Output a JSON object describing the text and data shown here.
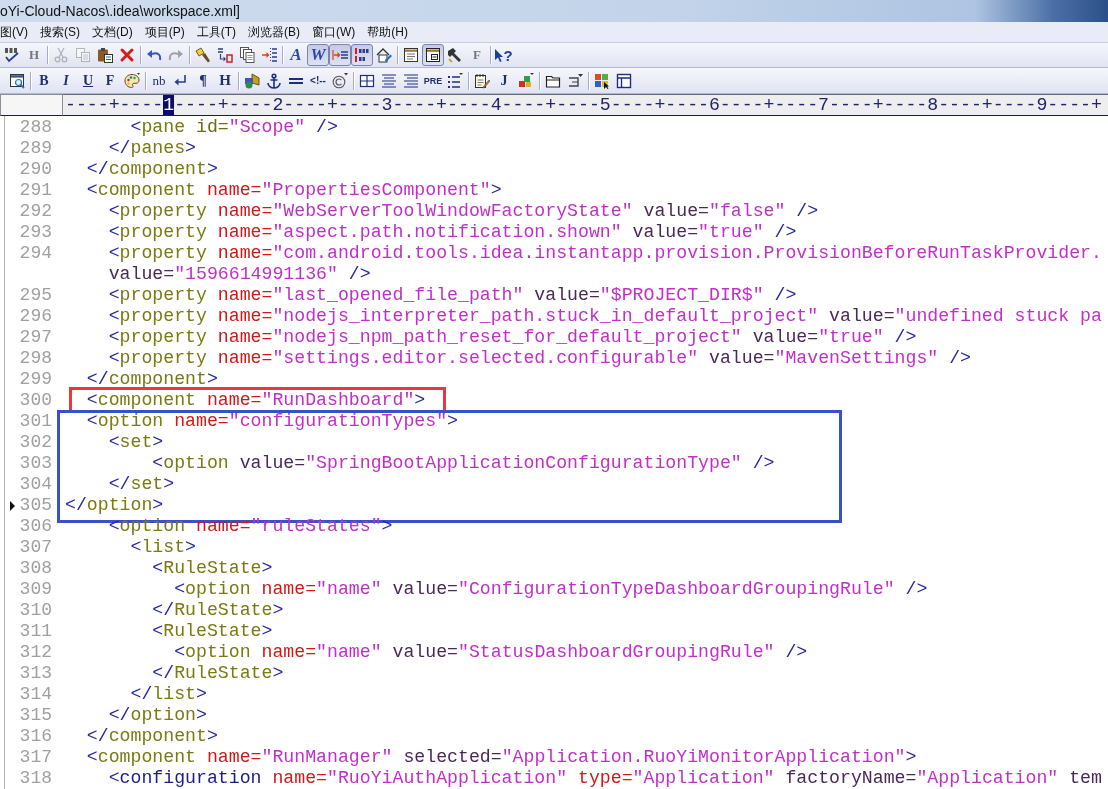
{
  "title_bar": {
    "title": "oYi-Cloud-Nacos\\.idea\\workspace.xml]"
  },
  "menu_bar": [
    "图(V)",
    "搜索(S)",
    "文档(D)",
    "项目(P)",
    "工具(T)",
    "浏览器(B)",
    "窗口(W)",
    "帮助(H)"
  ],
  "toolbars": [
    {
      "groups": [
        [
          {
            "kind": "command",
            "disabled": false
          },
          {
            "kind": "command",
            "label": "H",
            "disabled": false
          }
        ],
        [
          {
            "kind": "command",
            "disabled": true
          },
          {
            "kind": "command",
            "disabled": true
          },
          {
            "kind": "command",
            "disabled": false
          },
          {
            "kind": "command",
            "disabled": false
          }
        ],
        [
          {
            "kind": "command",
            "disabled": false
          },
          {
            "kind": "command",
            "disabled": true
          }
        ],
        [
          {
            "kind": "command",
            "disabled": false
          },
          {
            "kind": "command",
            "disabled": false
          },
          {
            "kind": "command",
            "disabled": false
          },
          {
            "kind": "command",
            "disabled": false
          }
        ],
        [
          {
            "kind": "command",
            "label": "A",
            "disabled": false
          },
          {
            "kind": "toggle",
            "label": "W",
            "pressed": true,
            "disabled": false
          },
          {
            "kind": "toggle",
            "pressed": true,
            "disabled": false
          },
          {
            "kind": "toggle",
            "pressed": true,
            "disabled": false
          },
          {
            "kind": "command",
            "disabled": false
          }
        ],
        [
          {
            "kind": "command",
            "disabled": false
          },
          {
            "kind": "toggle",
            "pressed": true,
            "disabled": false
          },
          {
            "kind": "command",
            "disabled": false
          },
          {
            "kind": "command",
            "label": "F",
            "disabled": false
          }
        ],
        [
          {
            "kind": "command",
            "label": "?",
            "disabled": false
          }
        ]
      ]
    },
    {
      "groups": [
        [
          {
            "kind": "command",
            "disabled": false
          }
        ],
        [
          {
            "kind": "command",
            "label": "B",
            "disabled": false
          },
          {
            "kind": "command",
            "label": "I",
            "disabled": false
          },
          {
            "kind": "command",
            "label": "U",
            "disabled": false
          },
          {
            "kind": "command",
            "label": "F",
            "disabled": false
          },
          {
            "kind": "command",
            "disabled": false
          }
        ],
        [
          {
            "kind": "command",
            "label": "nb",
            "disabled": false
          },
          {
            "kind": "command",
            "disabled": false
          },
          {
            "kind": "command",
            "label": "¶",
            "disabled": false
          },
          {
            "kind": "command",
            "label": "H",
            "disabled": false
          }
        ],
        [
          {
            "kind": "command",
            "disabled": false
          },
          {
            "kind": "command",
            "disabled": false
          },
          {
            "kind": "command",
            "disabled": false
          },
          {
            "kind": "command",
            "label": "<!--",
            "disabled": false
          },
          {
            "kind": "command",
            "disabled": false
          }
        ],
        [
          {
            "kind": "command",
            "disabled": false
          },
          {
            "kind": "command",
            "disabled": false
          },
          {
            "kind": "command",
            "disabled": false
          },
          {
            "kind": "command",
            "label": "PRE",
            "disabled": false
          },
          {
            "kind": "command",
            "disabled": false
          }
        ],
        [
          {
            "kind": "command",
            "disabled": false
          },
          {
            "kind": "command",
            "label": "J",
            "disabled": false
          },
          {
            "kind": "command",
            "disabled": false
          }
        ],
        [
          {
            "kind": "command",
            "disabled": false
          },
          {
            "kind": "command",
            "disabled": false
          }
        ],
        [
          {
            "kind": "command",
            "disabled": false
          },
          {
            "kind": "command",
            "disabled": false
          }
        ]
      ]
    }
  ],
  "ruler": [
    {
      "text": "----+----",
      "highlighted": false
    },
    {
      "text": "1",
      "highlighted": true
    },
    {
      "text": "----+----2----+----3----+----4----+----5----+----6----+----7----+----8----+----9----+",
      "highlighted": false
    }
  ],
  "code": {
    "blocks": [
      {
        "rows": [
          {
            "number": "288",
            "current": false,
            "tokens": [
              {
                "kind": "bracket",
                "text": "      <"
              },
              {
                "kind": "tag",
                "text": "pane"
              },
              {
                "kind": "property",
                "text": " id="
              },
              {
                "kind": "string",
                "text": "\"Scope\""
              },
              {
                "kind": "bracket",
                "text": " />"
              }
            ]
          },
          {
            "number": "289",
            "current": false,
            "tokens": [
              {
                "kind": "bracket",
                "text": "    </"
              },
              {
                "kind": "tag",
                "text": "panes"
              },
              {
                "kind": "bracket",
                "text": ">"
              }
            ]
          },
          {
            "number": "290",
            "current": false,
            "tokens": [
              {
                "kind": "bracket",
                "text": "  </"
              },
              {
                "kind": "tag",
                "text": "component"
              },
              {
                "kind": "bracket",
                "text": ">"
              }
            ]
          },
          {
            "number": "291",
            "current": false,
            "tokens": [
              {
                "kind": "bracket",
                "text": "  <"
              },
              {
                "kind": "tag",
                "text": "component"
              },
              {
                "kind": "keyword",
                "text": " name="
              },
              {
                "kind": "string",
                "text": "\"PropertiesComponent\""
              },
              {
                "kind": "bracket",
                "text": ">"
              }
            ]
          },
          {
            "number": "292",
            "current": false,
            "tokens": [
              {
                "kind": "bracket",
                "text": "    <"
              },
              {
                "kind": "tag",
                "text": "property"
              },
              {
                "kind": "keyword",
                "text": " name="
              },
              {
                "kind": "string",
                "text": "\"WebServerToolWindowFactoryState\""
              },
              {
                "kind": "attribute",
                "text": " value="
              },
              {
                "kind": "string",
                "text": "\"false\""
              },
              {
                "kind": "bracket",
                "text": " />"
              }
            ]
          },
          {
            "number": "293",
            "current": false,
            "tokens": [
              {
                "kind": "bracket",
                "text": "    <"
              },
              {
                "kind": "tag",
                "text": "property"
              },
              {
                "kind": "keyword",
                "text": " name="
              },
              {
                "kind": "string",
                "text": "\"aspect.path.notification.shown\""
              },
              {
                "kind": "attribute",
                "text": " value="
              },
              {
                "kind": "string",
                "text": "\"true\""
              },
              {
                "kind": "bracket",
                "text": " />"
              }
            ]
          },
          {
            "number": "294",
            "current": false,
            "tokens": [
              {
                "kind": "bracket",
                "text": "    <"
              },
              {
                "kind": "tag",
                "text": "property"
              },
              {
                "kind": "keyword",
                "text": " name="
              },
              {
                "kind": "string",
                "text": "\"com.android.tools.idea.instantapp.provision.ProvisionBeforeRunTaskProvider."
              }
            ]
          },
          {
            "current": false,
            "tokens": [
              {
                "kind": "attribute",
                "text": "    value="
              },
              {
                "kind": "string",
                "text": "\"1596614991136\""
              },
              {
                "kind": "bracket",
                "text": " />"
              }
            ]
          },
          {
            "number": "295",
            "current": false,
            "tokens": [
              {
                "kind": "bracket",
                "text": "    <"
              },
              {
                "kind": "tag",
                "text": "property"
              },
              {
                "kind": "keyword",
                "text": " name="
              },
              {
                "kind": "string",
                "text": "\"last_opened_file_path\""
              },
              {
                "kind": "attribute",
                "text": " value="
              },
              {
                "kind": "string",
                "text": "\"$PROJECT_DIR$\""
              },
              {
                "kind": "bracket",
                "text": " />"
              }
            ]
          },
          {
            "number": "296",
            "current": false,
            "tokens": [
              {
                "kind": "bracket",
                "text": "    <"
              },
              {
                "kind": "tag",
                "text": "property"
              },
              {
                "kind": "keyword",
                "text": " name="
              },
              {
                "kind": "string",
                "text": "\"nodejs_interpreter_path.stuck_in_default_project\""
              },
              {
                "kind": "attribute",
                "text": " value="
              },
              {
                "kind": "string",
                "text": "\"undefined stuck pa"
              }
            ]
          },
          {
            "number": "297",
            "current": false,
            "tokens": [
              {
                "kind": "bracket",
                "text": "    <"
              },
              {
                "kind": "tag",
                "text": "property"
              },
              {
                "kind": "keyword",
                "text": " name="
              },
              {
                "kind": "string",
                "text": "\"nodejs_npm_path_reset_for_default_project\""
              },
              {
                "kind": "attribute",
                "text": " value="
              },
              {
                "kind": "string",
                "text": "\"true\""
              },
              {
                "kind": "bracket",
                "text": " />"
              }
            ]
          },
          {
            "number": "298",
            "current": false,
            "tokens": [
              {
                "kind": "bracket",
                "text": "    <"
              },
              {
                "kind": "tag",
                "text": "property"
              },
              {
                "kind": "keyword",
                "text": " name="
              },
              {
                "kind": "string",
                "text": "\"settings.editor.selected.configurable\""
              },
              {
                "kind": "attribute",
                "text": " value="
              },
              {
                "kind": "string",
                "text": "\"MavenSettings\""
              },
              {
                "kind": "bracket",
                "text": " />"
              }
            ]
          },
          {
            "number": "299",
            "current": false,
            "tokens": [
              {
                "kind": "bracket",
                "text": "  </"
              },
              {
                "kind": "tag",
                "text": "component"
              },
              {
                "kind": "bracket",
                "text": ">"
              }
            ]
          }
        ]
      },
      {
        "frame": {
          "color": "#e8383c"
        },
        "rows": [
          {
            "number": "300",
            "current": false,
            "tokens": [
              {
                "kind": "bracket",
                "text": "  <"
              },
              {
                "kind": "tag",
                "text": "component"
              },
              {
                "kind": "keyword",
                "text": " name="
              },
              {
                "kind": "string",
                "text": "\"RunDashboard\""
              },
              {
                "kind": "bracket",
                "text": ">"
              }
            ]
          }
        ]
      },
      {
        "frame": {
          "color": "#3a50c6"
        },
        "rows": [
          {
            "number": "301",
            "current": false,
            "tokens": [
              {
                "kind": "bracket",
                "text": "  <"
              },
              {
                "kind": "tag",
                "text": "option"
              },
              {
                "kind": "keyword",
                "text": " name="
              },
              {
                "kind": "string",
                "text": "\"configurationTypes\""
              },
              {
                "kind": "bracket",
                "text": ">"
              }
            ]
          },
          {
            "number": "302",
            "current": false,
            "tokens": [
              {
                "kind": "bracket",
                "text": "    <"
              },
              {
                "kind": "tag",
                "text": "set"
              },
              {
                "kind": "bracket",
                "text": ">"
              }
            ]
          },
          {
            "number": "303",
            "current": false,
            "tokens": [
              {
                "kind": "bracket",
                "text": "        <"
              },
              {
                "kind": "tag",
                "text": "option"
              },
              {
                "kind": "attribute",
                "text": " value="
              },
              {
                "kind": "string",
                "text": "\"SpringBootApplicationConfigurationType\""
              },
              {
                "kind": "bracket",
                "text": " />"
              }
            ]
          },
          {
            "number": "304",
            "current": false,
            "tokens": [
              {
                "kind": "bracket",
                "text": "    </"
              },
              {
                "kind": "tag",
                "text": "set"
              },
              {
                "kind": "bracket",
                "text": ">"
              }
            ]
          },
          {
            "number": "305",
            "current": true,
            "tokens": [
              {
                "kind": "bracket",
                "text": "</"
              },
              {
                "kind": "tag",
                "text": "option"
              },
              {
                "kind": "bracket",
                "text": ">"
              }
            ]
          }
        ]
      },
      {
        "rows": [
          {
            "number": "306",
            "current": false,
            "tokens": [
              {
                "kind": "bracket",
                "text": "    <"
              },
              {
                "kind": "tag",
                "text": "option"
              },
              {
                "kind": "keyword",
                "text": " name="
              },
              {
                "kind": "string",
                "text": "\"ruleStates\""
              },
              {
                "kind": "bracket",
                "text": ">"
              }
            ]
          },
          {
            "number": "307",
            "current": false,
            "tokens": [
              {
                "kind": "bracket",
                "text": "      <"
              },
              {
                "kind": "tag",
                "text": "list"
              },
              {
                "kind": "bracket",
                "text": ">"
              }
            ]
          },
          {
            "number": "308",
            "current": false,
            "tokens": [
              {
                "kind": "bracket",
                "text": "        <"
              },
              {
                "kind": "tag",
                "text": "RuleState"
              },
              {
                "kind": "bracket",
                "text": ">"
              }
            ]
          },
          {
            "number": "309",
            "current": false,
            "tokens": [
              {
                "kind": "bracket",
                "text": "          <"
              },
              {
                "kind": "tag",
                "text": "option"
              },
              {
                "kind": "keyword",
                "text": " name="
              },
              {
                "kind": "string",
                "text": "\"name\""
              },
              {
                "kind": "attribute",
                "text": " value="
              },
              {
                "kind": "string",
                "text": "\"ConfigurationTypeDashboardGroupingRule\""
              },
              {
                "kind": "bracket",
                "text": " />"
              }
            ]
          },
          {
            "number": "310",
            "current": false,
            "tokens": [
              {
                "kind": "bracket",
                "text": "        </"
              },
              {
                "kind": "tag",
                "text": "RuleState"
              },
              {
                "kind": "bracket",
                "text": ">"
              }
            ]
          },
          {
            "number": "311",
            "current": false,
            "tokens": [
              {
                "kind": "bracket",
                "text": "        <"
              },
              {
                "kind": "tag",
                "text": "RuleState"
              },
              {
                "kind": "bracket",
                "text": ">"
              }
            ]
          },
          {
            "number": "312",
            "current": false,
            "tokens": [
              {
                "kind": "bracket",
                "text": "          <"
              },
              {
                "kind": "tag",
                "text": "option"
              },
              {
                "kind": "keyword",
                "text": " name="
              },
              {
                "kind": "string",
                "text": "\"name\""
              },
              {
                "kind": "attribute",
                "text": " value="
              },
              {
                "kind": "string",
                "text": "\"StatusDashboardGroupingRule\""
              },
              {
                "kind": "bracket",
                "text": " />"
              }
            ]
          },
          {
            "number": "313",
            "current": false,
            "tokens": [
              {
                "kind": "bracket",
                "text": "        </"
              },
              {
                "kind": "tag",
                "text": "RuleState"
              },
              {
                "kind": "bracket",
                "text": ">"
              }
            ]
          },
          {
            "number": "314",
            "current": false,
            "tokens": [
              {
                "kind": "bracket",
                "text": "      </"
              },
              {
                "kind": "tag",
                "text": "list"
              },
              {
                "kind": "bracket",
                "text": ">"
              }
            ]
          },
          {
            "number": "315",
            "current": false,
            "tokens": [
              {
                "kind": "bracket",
                "text": "    </"
              },
              {
                "kind": "tag",
                "text": "option"
              },
              {
                "kind": "bracket",
                "text": ">"
              }
            ]
          },
          {
            "number": "316",
            "current": false,
            "tokens": [
              {
                "kind": "bracket",
                "text": "  </"
              },
              {
                "kind": "tag",
                "text": "component"
              },
              {
                "kind": "bracket",
                "text": ">"
              }
            ]
          },
          {
            "number": "317",
            "current": false,
            "tokens": [
              {
                "kind": "bracket",
                "text": "  <"
              },
              {
                "kind": "tag",
                "text": "component"
              },
              {
                "kind": "keyword",
                "text": " name="
              },
              {
                "kind": "string",
                "text": "\"RunManager\""
              },
              {
                "kind": "attribute",
                "text": " selected="
              },
              {
                "kind": "string",
                "text": "\"Application.RuoYiMonitorApplication\""
              },
              {
                "kind": "bracket",
                "text": ">"
              }
            ]
          },
          {
            "number": "318",
            "current": false,
            "tokens": [
              {
                "kind": "bracket",
                "text": "    <"
              },
              {
                "kind": "element",
                "text": "configuration"
              },
              {
                "kind": "keyword",
                "text": " name="
              },
              {
                "kind": "string",
                "text": "\"RuoYiAuthApplication\""
              },
              {
                "kind": "keyword",
                "text": " type="
              },
              {
                "kind": "string",
                "text": "\"Application\""
              },
              {
                "kind": "attribute",
                "text": " factoryName="
              },
              {
                "kind": "string",
                "text": "\"Application\""
              },
              {
                "kind": "attribute",
                "text": " tem"
              }
            ]
          }
        ]
      }
    ]
  }
}
